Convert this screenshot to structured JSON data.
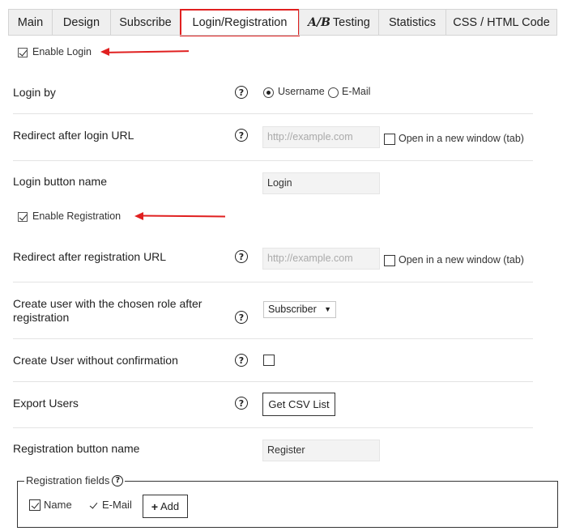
{
  "tabs": [
    {
      "label": "Main"
    },
    {
      "label": "Design"
    },
    {
      "label": "Subscribe"
    },
    {
      "label": "Login/Registration"
    },
    {
      "label": "Testing",
      "prefix": "A/B"
    },
    {
      "label": "Statistics"
    },
    {
      "label": "CSS / HTML Code"
    }
  ],
  "active_tab": "Login/Registration",
  "accent_color": "#e02020",
  "login": {
    "enable_label": "Enable Login",
    "enable_checked": true,
    "login_by": {
      "label": "Login by",
      "options": [
        "Username",
        "E-Mail"
      ],
      "selected": "Username"
    },
    "redirect": {
      "label": "Redirect after login URL",
      "placeholder": "http://example.com",
      "new_window_label": "Open in a new window (tab)",
      "new_window_checked": false
    },
    "button_name": {
      "label": "Login button name",
      "value": "Login"
    }
  },
  "registration": {
    "enable_label": "Enable Registration",
    "enable_checked": true,
    "redirect": {
      "label": "Redirect after registration URL",
      "placeholder": "http://example.com",
      "new_window_label": "Open in a new window (tab)",
      "new_window_checked": false
    },
    "role": {
      "label_line1": "Create user with the chosen role after",
      "label_line2": "registration",
      "value": "Subscriber"
    },
    "no_confirm": {
      "label": "Create User without confirmation",
      "checked": false
    },
    "export": {
      "label": "Export Users",
      "button": "Get CSV List"
    },
    "button_name": {
      "label": "Registration button name",
      "value": "Register"
    },
    "fields": {
      "legend": "Registration fields",
      "items": [
        {
          "label": "Name",
          "checked": true
        },
        {
          "label": "E-Mail",
          "checked": true
        }
      ],
      "add_button": "Add"
    }
  },
  "help_glyph": "?",
  "icons": [
    "help-icon",
    "plus-icon",
    "red-arrow-annotation"
  ]
}
